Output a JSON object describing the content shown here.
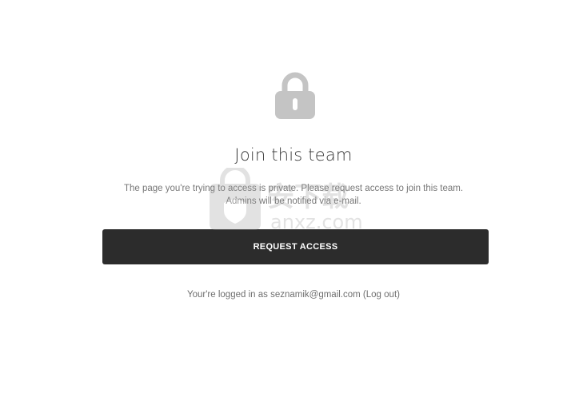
{
  "page": {
    "lock_icon": "lock-icon",
    "title": "Join this team",
    "description_line1": "The page you're trying to access is private. Please request access to join this team.",
    "description_line2": "Admins will be notified via e-mail.",
    "request_button_label": "REQUEST ACCESS",
    "login_prefix": "Your're logged in as ",
    "login_email": "seznamik@gmail.com",
    "logout_open": " (",
    "logout_label": "Log out",
    "logout_close": ")"
  },
  "watermark": {
    "text": "anxz.com",
    "cjk": "安下载"
  },
  "colors": {
    "button_bg": "#2c2c2c",
    "lock_gray": "#c4c4c4"
  }
}
